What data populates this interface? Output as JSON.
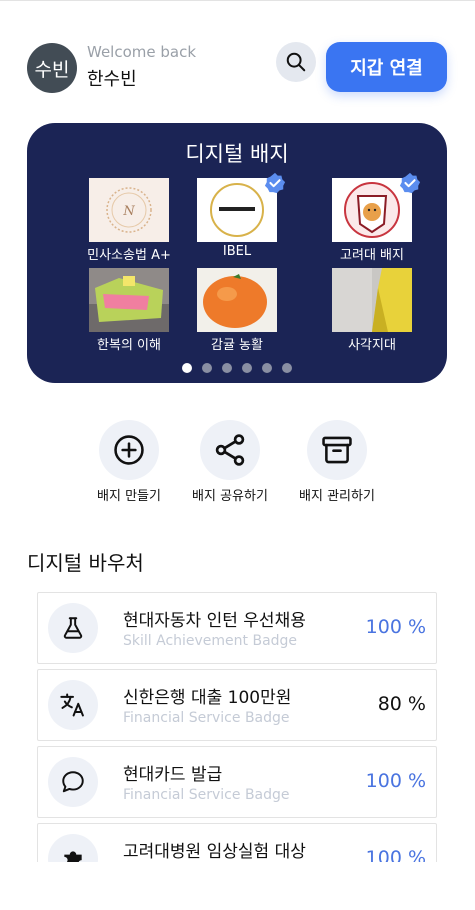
{
  "header": {
    "avatar_text": "수빈",
    "welcome": "Welcome back",
    "username": "한수빈",
    "wallet_button": "지갑 연결"
  },
  "badges": {
    "title": "디지털 배지",
    "items": [
      {
        "label": "민사소송법 A+",
        "verified": false
      },
      {
        "label": "IBEL",
        "verified": true
      },
      {
        "label": "고려대 배지",
        "verified": true
      },
      {
        "label": "한복의 이해",
        "verified": false
      },
      {
        "label": "감귤 농활",
        "verified": false
      },
      {
        "label": "사각지대",
        "verified": false
      }
    ],
    "page_count": 6,
    "active_page": 1
  },
  "actions": [
    {
      "label": "배지 만들기",
      "icon": "plus-circle-icon"
    },
    {
      "label": "배지 공유하기",
      "icon": "share-icon"
    },
    {
      "label": "배지 관리하기",
      "icon": "archive-icon"
    }
  ],
  "vouchers": {
    "title": "디지털 바우처",
    "items": [
      {
        "title": "현대자동차 인턴 우선채용",
        "subtitle": "Skill Achievement Badge",
        "percent": "100 %",
        "icon": "flask-icon"
      },
      {
        "title": "신한은행 대출 100만원",
        "subtitle": "Financial Service Badge",
        "percent": "80 %",
        "icon": "translate-icon"
      },
      {
        "title": "현대카드 발급",
        "subtitle": "Financial Service Badge",
        "percent": "100 %",
        "icon": "chat-bubble-icon"
      },
      {
        "title": "고려대병원 임상실험 대상",
        "subtitle": "",
        "percent": "100 %",
        "icon": "puzzle-icon"
      }
    ]
  },
  "colors": {
    "accent": "#3a75f2",
    "card_bg": "#1b2455",
    "percent_blue": "#4a74e0"
  }
}
